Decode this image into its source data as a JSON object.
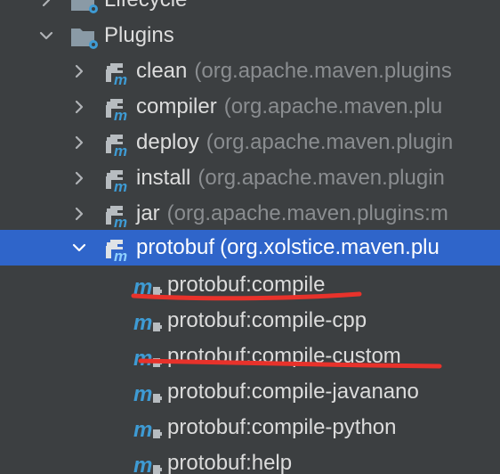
{
  "tree": {
    "lifecycle_node": {
      "label": "Lifecycle",
      "icon": "folder-settings-icon",
      "expanded": false
    },
    "plugins_node": {
      "label": "Plugins",
      "icon": "folder-settings-icon",
      "expanded": true
    },
    "plugins": [
      {
        "name": "clean",
        "group": "(org.apache.maven.plugins"
      },
      {
        "name": "compiler",
        "group": "(org.apache.maven.plu"
      },
      {
        "name": "deploy",
        "group": "(org.apache.maven.plugin"
      },
      {
        "name": "install",
        "group": "(org.apache.maven.plugin"
      },
      {
        "name": "jar",
        "group": "(org.apache.maven.plugins:m"
      },
      {
        "name": "protobuf",
        "group": "(org.xolstice.maven.plu",
        "selected": true,
        "expanded": true
      }
    ],
    "goals": [
      {
        "label": "protobuf:compile",
        "underlined": true
      },
      {
        "label": "protobuf:compile-cpp"
      },
      {
        "label": "protobuf:compile-custom",
        "underlined": true
      },
      {
        "label": "protobuf:compile-javanano"
      },
      {
        "label": "protobuf:compile-python"
      },
      {
        "label": "protobuf:help"
      }
    ]
  },
  "colors": {
    "background": "#3c3f41",
    "selection": "#2f65ca",
    "text": "#dddddd",
    "group_text": "#8a8d90",
    "maven_blue": "#3e9bd4",
    "annotation_red": "#e8322b"
  }
}
